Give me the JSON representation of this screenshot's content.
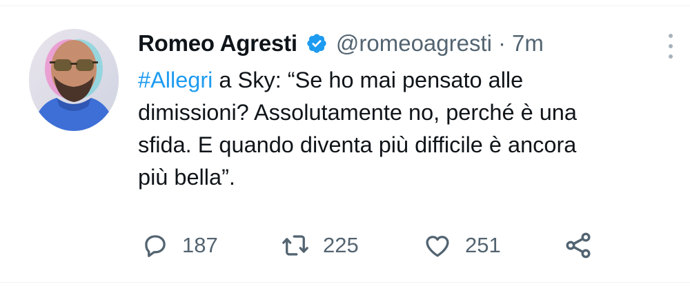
{
  "tweet": {
    "author": {
      "display_name": "Romeo Agresti",
      "handle": "@romeoagresti",
      "verified": true
    },
    "separator": "·",
    "time": "7m",
    "text": {
      "hashtag": "#Allegri",
      "line1_rest": " a Sky: “Se ho mai pensato alle",
      "line2": "dimissioni? Assolutamente no, perché è una",
      "line3": "sfida. E quando diventa più difficile è ancora",
      "line4": "più bella”."
    },
    "actions": {
      "replies": "187",
      "retweets": "225",
      "likes": "251"
    }
  },
  "icons": {
    "reply": "speech-bubble-icon",
    "retweet": "retweet-arrows-icon",
    "like": "heart-icon",
    "share": "share-icon",
    "more": "vertical-dots-icon",
    "verified": "verified-badge-icon"
  },
  "colors": {
    "link_blue": "#1d9bf0",
    "muted_gray": "#536471",
    "text_dark": "#0f1419"
  }
}
